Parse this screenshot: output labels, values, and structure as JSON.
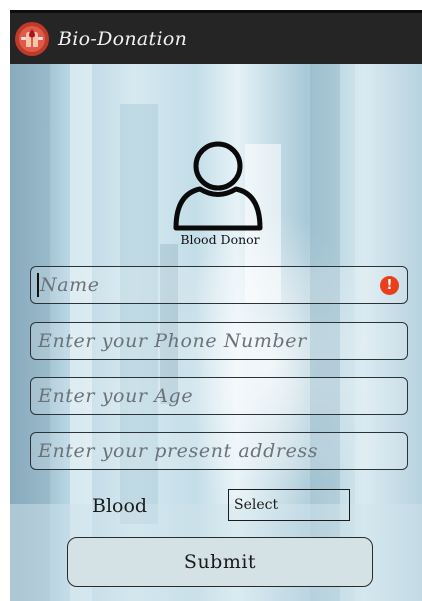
{
  "appbar": {
    "title": "Bio-Donation",
    "icon": "blood-donation-logo-icon"
  },
  "profile": {
    "icon": "user-outline-icon",
    "label": "Blood Donor"
  },
  "form": {
    "name_placeholder": "Name",
    "name_error_icon": "exclamation-icon",
    "phone_placeholder": "Enter your Phone Number",
    "age_placeholder": "Enter your Age",
    "address_placeholder": "Enter your present address",
    "blood_label": "Blood",
    "blood_select_value": "Select",
    "submit_label": "Submit"
  },
  "colors": {
    "appbar_bg": "#252525",
    "error": "#e8401c",
    "submit_bg": "#d4e2e6"
  }
}
